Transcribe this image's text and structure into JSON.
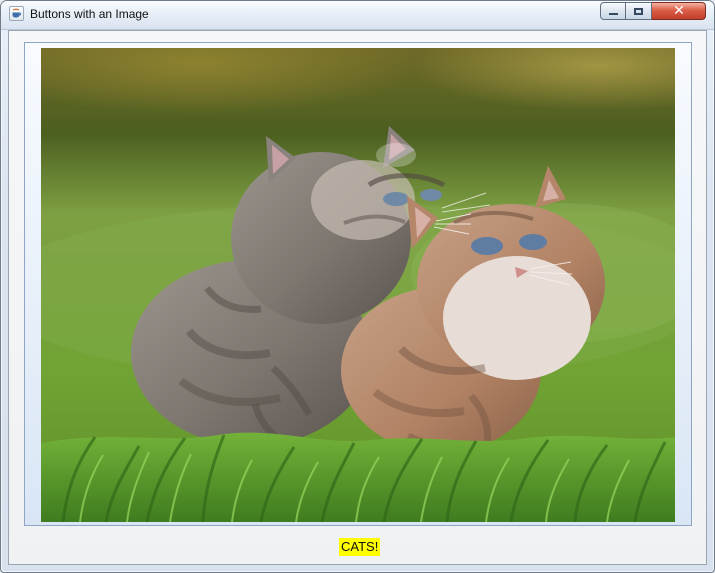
{
  "window": {
    "title": "Buttons with an Image"
  },
  "icons": {
    "app": "java-icon",
    "minimize": "minimize-icon",
    "maximize": "maximize-icon",
    "close": "close-icon"
  },
  "main": {
    "caption_label": "CATS!"
  },
  "colors": {
    "caption_bg": "#ffff00",
    "close_button": "#d6553f"
  }
}
